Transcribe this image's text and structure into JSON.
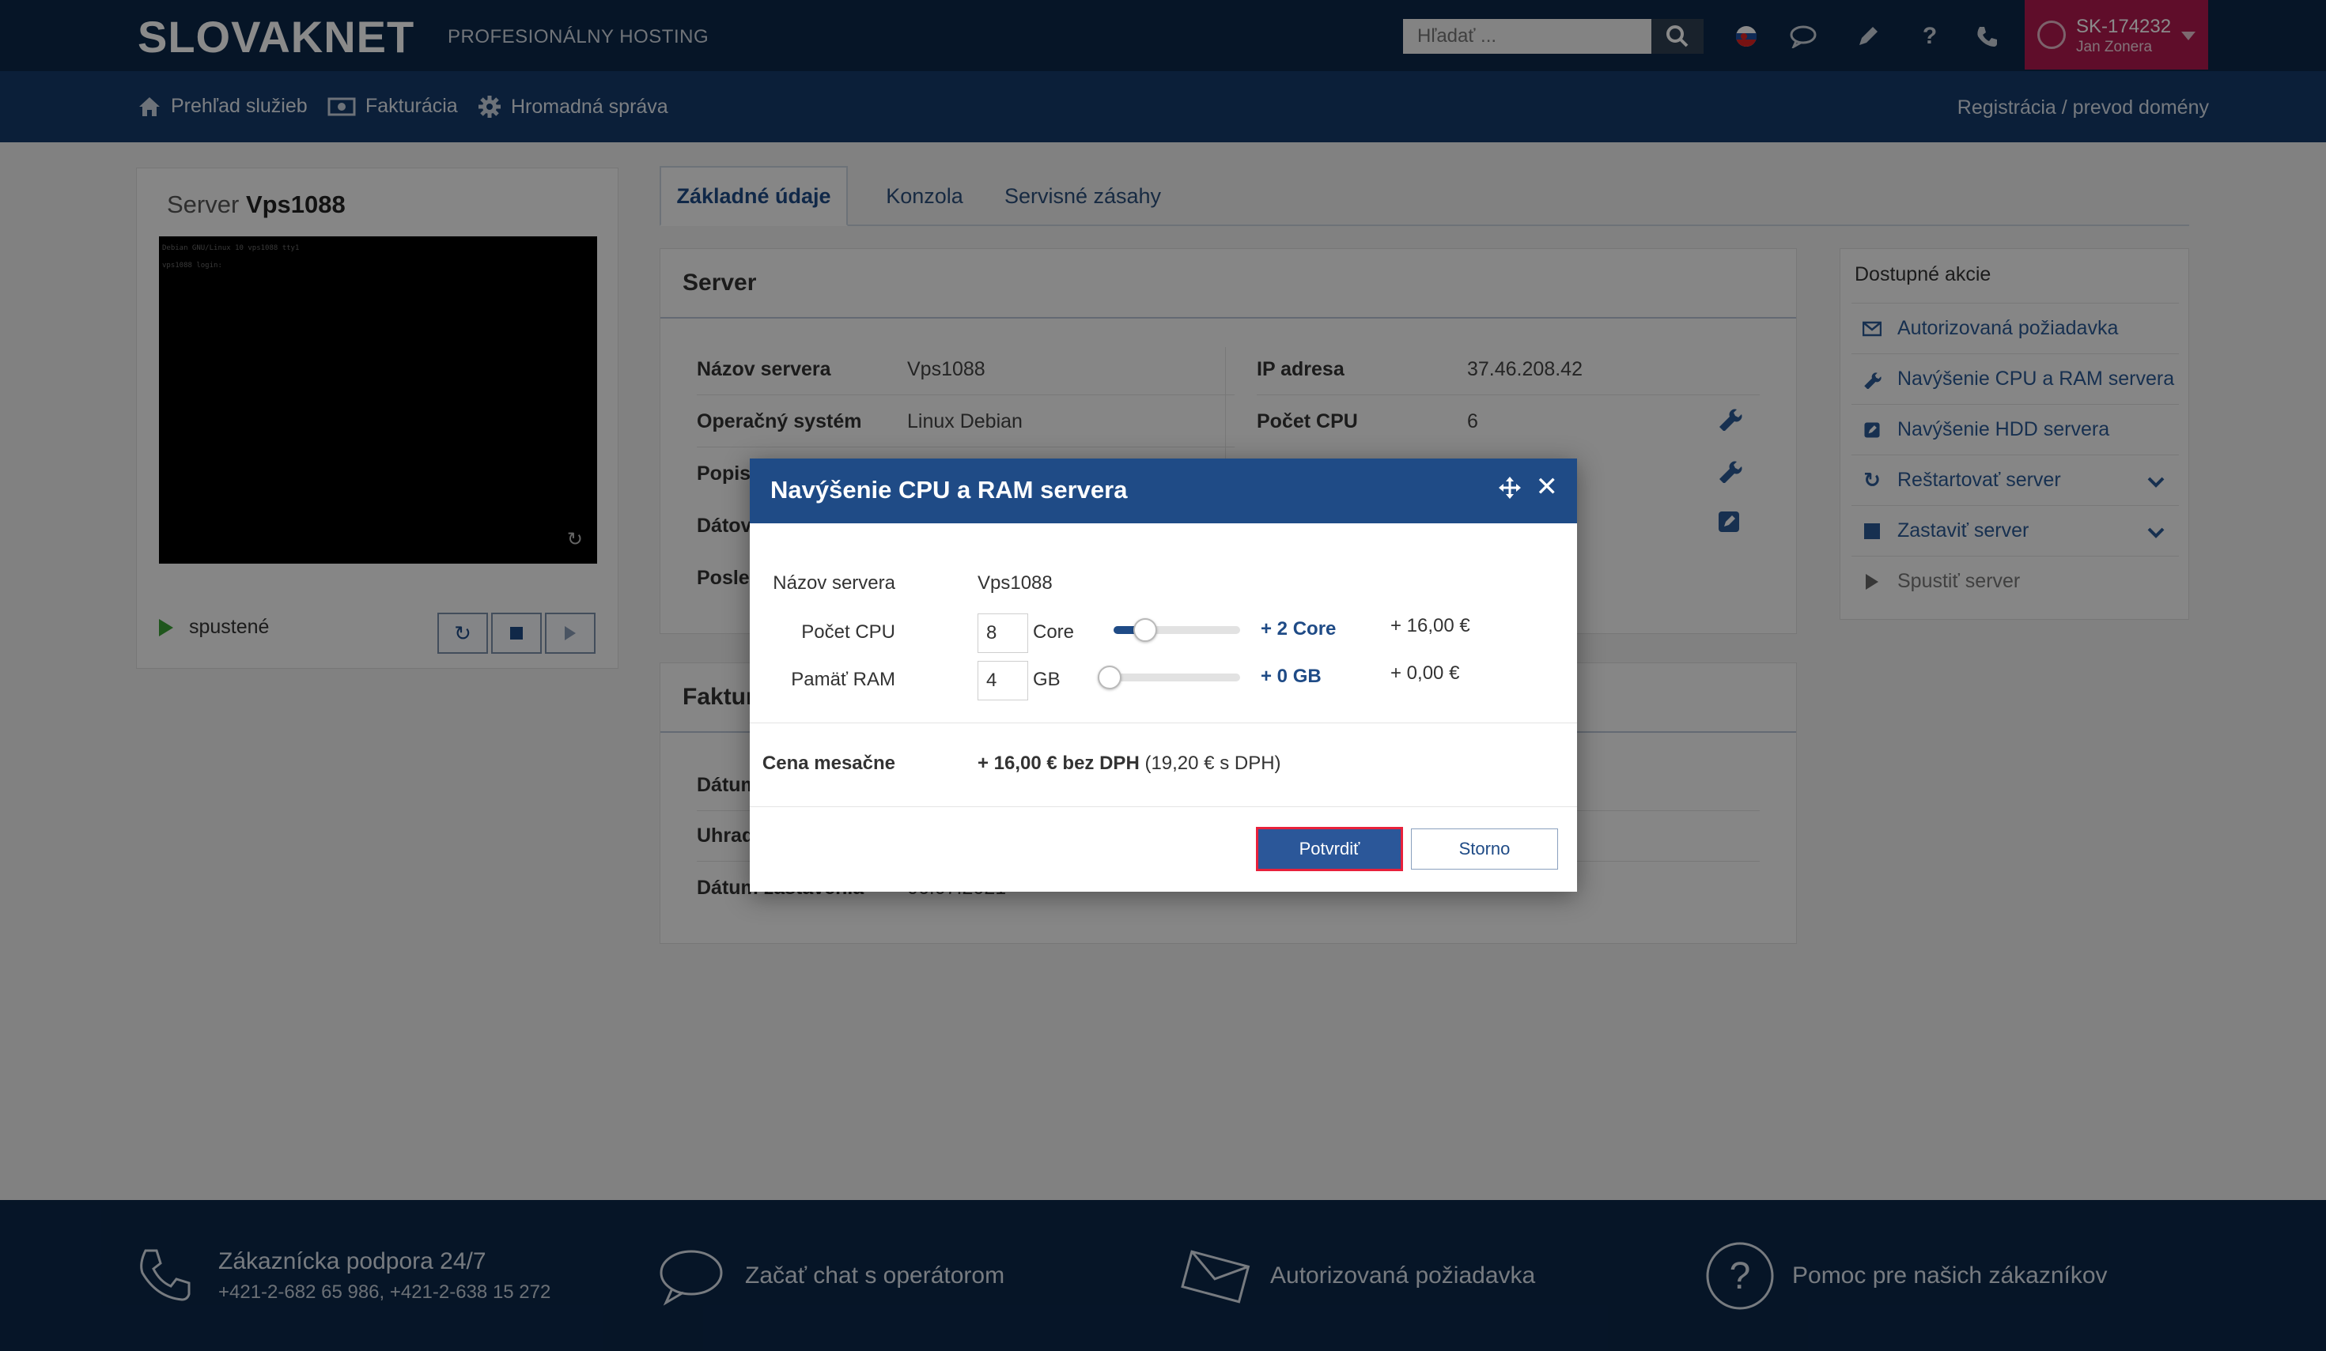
{
  "header": {
    "logo": "SLOVAKNET",
    "tagline": "PROFESIONÁLNY HOSTING",
    "search_placeholder": "Hľadať ...",
    "account_id": "SK-174232",
    "account_name": "Jan Zonera"
  },
  "nav": {
    "items": [
      {
        "label": "Prehľad služieb",
        "icon": "home-icon"
      },
      {
        "label": "Fakturácia",
        "icon": "money-icon"
      },
      {
        "label": "Hromadná správa",
        "icon": "gear-icon"
      }
    ],
    "right_link": "Registrácia / prevod domény"
  },
  "server_card": {
    "title_prefix": "Server",
    "title_name": "Vps1088",
    "console_lines": [
      "Debian GNU/Linux 10 vps1088 tty1",
      "vps1088 login:"
    ],
    "status": "spustené"
  },
  "tabs": [
    "Základné údaje",
    "Konzola",
    "Servisné zásahy"
  ],
  "server_panel": {
    "title": "Server",
    "left_rows": [
      {
        "label": "Názov servera",
        "value": "Vps1088"
      },
      {
        "label": "Operačný systém",
        "value": "Linux Debian"
      },
      {
        "label": "Popis",
        "value": ""
      },
      {
        "label": "Dátov",
        "value": ""
      },
      {
        "label": "Posled",
        "value": ""
      }
    ],
    "right_rows": [
      {
        "label": "IP adresa",
        "value": "37.46.208.42"
      },
      {
        "label": "Počet CPU",
        "value": "6"
      }
    ]
  },
  "billing_panel": {
    "title": "Faktur",
    "rows": [
      {
        "label": "Dátum",
        "value": ""
      },
      {
        "label": "Uhrad",
        "value": ""
      },
      {
        "label": "Dátum zastavenia",
        "value": "06.07.2021"
      }
    ]
  },
  "actions": {
    "title": "Dostupné akcie",
    "items": [
      {
        "label": "Autorizovaná požiadavka",
        "icon": "envelope-icon"
      },
      {
        "label": "Navýšenie CPU a RAM servera",
        "icon": "wrench-icon"
      },
      {
        "label": "Navýšenie HDD servera",
        "icon": "edit-icon"
      },
      {
        "label": "Reštartovať server",
        "icon": "refresh-icon"
      },
      {
        "label": "Zastaviť server",
        "icon": "stop-icon"
      },
      {
        "label": "Spustiť server",
        "icon": "play-icon"
      }
    ]
  },
  "modal": {
    "title": "Navýšenie CPU a RAM servera",
    "server_label": "Názov servera",
    "server_value": "Vps1088",
    "cpu_label": "Počet CPU",
    "cpu_value": "8",
    "cpu_unit": "Core",
    "cpu_increase": "+ 2 Core",
    "cpu_price": "+ 16,00 €",
    "cpu_slider_fraction": 0.2,
    "ram_label": "Pamäť RAM",
    "ram_value": "4",
    "ram_unit": "GB",
    "ram_increase": "+ 0 GB",
    "ram_price": "+ 0,00 €",
    "ram_slider_fraction": 0,
    "price_label": "Cena mesačne",
    "price_main": "+ 16,00 € bez DPH",
    "price_vat": "(19,20 € s DPH)",
    "confirm_label": "Potvrdiť",
    "cancel_label": "Storno"
  },
  "footer": {
    "support_title": "Zákaznícka podpora 24/7",
    "support_phones": "+421-2-682 65 986, +421-2-638 15 272",
    "chat": "Začať chat s operátorom",
    "request": "Autorizovaná požiadavka",
    "help": "Pomoc pre našich zákazníkov"
  },
  "colors": {
    "header_bg": "#0c2749",
    "nav_bg": "#163a69",
    "modal_header": "#1f4b86",
    "account_bg": "#b0184f",
    "confirm_outline": "#e8213b"
  }
}
